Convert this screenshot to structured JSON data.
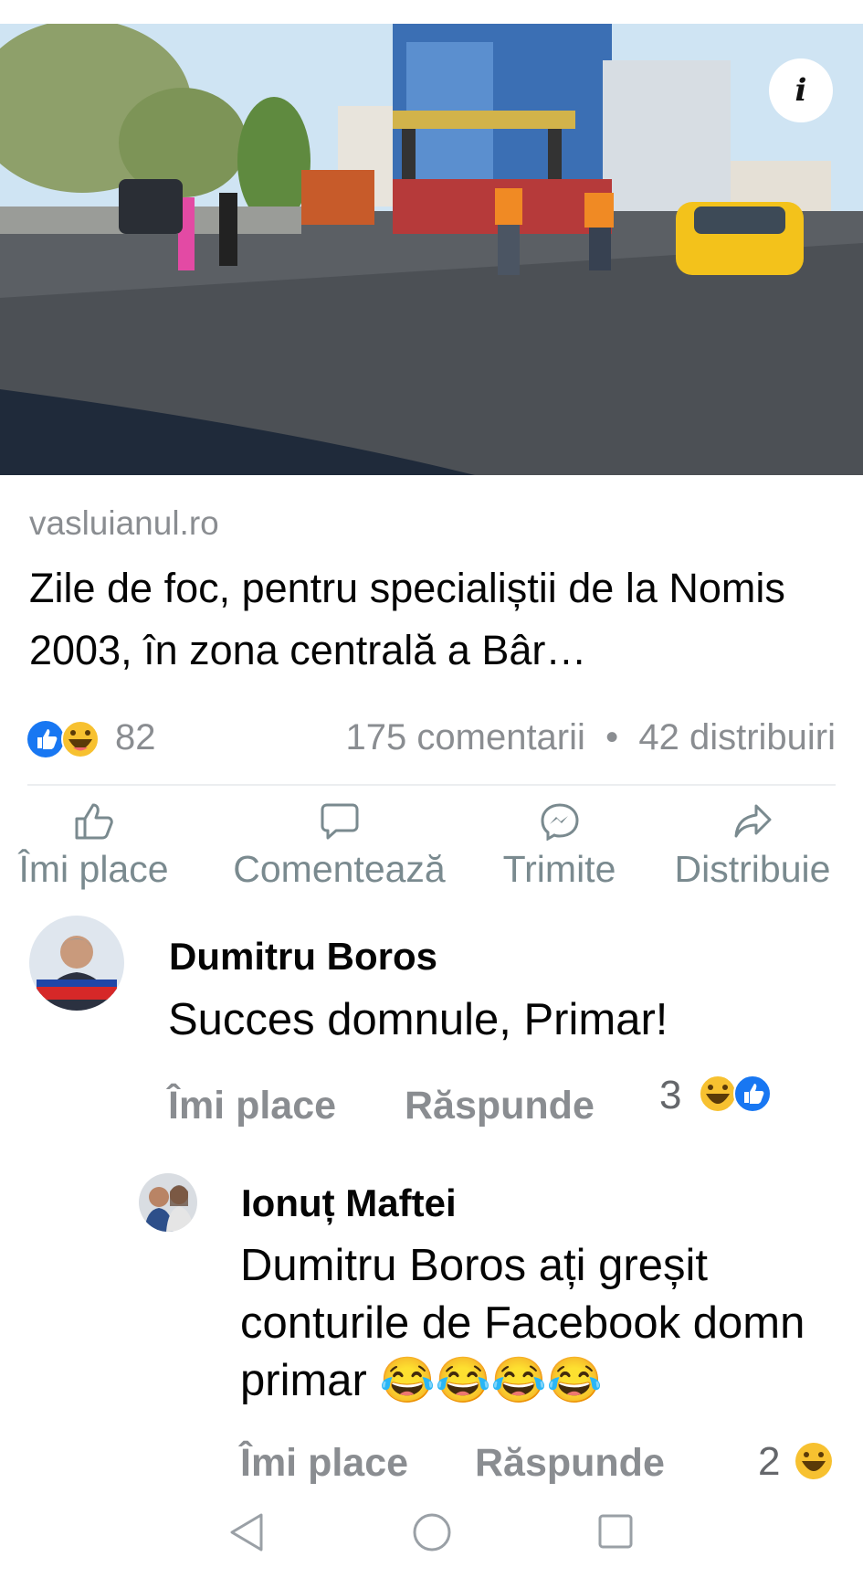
{
  "post": {
    "link_domain": "vasluianul.ro",
    "link_title": "Zile de foc, pentru specialiștii de la Nomis 2003, în zona centrală a Bâr…",
    "info_label": "i"
  },
  "stats": {
    "reactions_count": "82",
    "comments_shares": "175 comentarii  •  42 distribuiri"
  },
  "actions": {
    "like": "Îmi place",
    "comment": "Comentează",
    "send": "Trimite",
    "share": "Distribuie"
  },
  "comments": [
    {
      "author": "Dumitru Boros",
      "text": "Succes domnule, Primar!",
      "like": "Îmi place",
      "reply": "Răspunde",
      "reactions_count": "3"
    },
    {
      "author": "Ionuț Maftei",
      "text": "Dumitru Boros ați greșit conturile de Facebook domn primar 😂😂😂😂",
      "like": "Îmi place",
      "reply": "Răspunde",
      "reactions_count": "2"
    }
  ],
  "colors": {
    "like_blue": "#1877f2",
    "haha_yellow": "#f7c130",
    "muted_text": "#8a8d91"
  }
}
